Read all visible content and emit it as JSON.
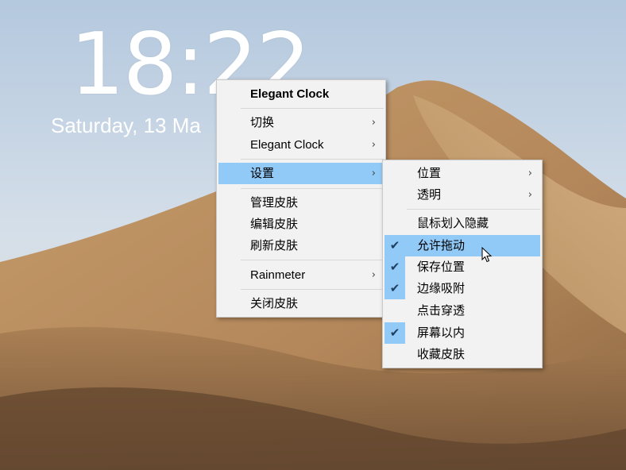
{
  "clock": {
    "time": "18:22",
    "date": "Saturday, 13 Ma"
  },
  "main_menu": {
    "title": "Elegant Clock",
    "items": [
      {
        "label": "切换",
        "submenu": true
      },
      {
        "label": "Elegant Clock",
        "submenu": true
      },
      {
        "label": "设置",
        "submenu": true,
        "highlighted": true
      },
      {
        "label": "管理皮肤"
      },
      {
        "label": "编辑皮肤"
      },
      {
        "label": "刷新皮肤"
      },
      {
        "label": "Rainmeter",
        "submenu": true
      },
      {
        "label": "关闭皮肤"
      }
    ]
  },
  "settings_menu": {
    "items": [
      {
        "label": "位置",
        "submenu": true
      },
      {
        "label": "透明",
        "submenu": true
      },
      {
        "label": "鼠标划入隐藏",
        "checked": false
      },
      {
        "label": "允许拖动",
        "checked": true,
        "highlighted": true
      },
      {
        "label": "保存位置",
        "checked": true
      },
      {
        "label": "边缘吸附",
        "checked": true
      },
      {
        "label": "点击穿透",
        "checked": false
      },
      {
        "label": "屏幕以内",
        "checked": true
      },
      {
        "label": "收藏皮肤",
        "checked": false
      }
    ]
  },
  "glyphs": {
    "arrow": "›",
    "check": "✔"
  },
  "colors": {
    "highlight": "#91c9f7",
    "menu_bg": "#f2f2f2",
    "sky": "#c6d4e3",
    "sand": "#c49a6c"
  }
}
